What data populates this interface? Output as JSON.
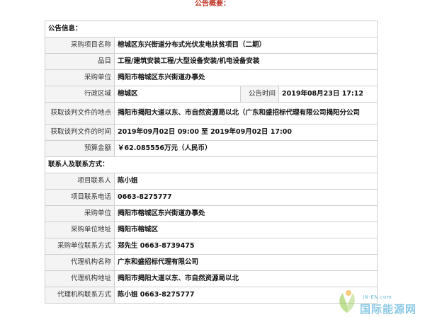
{
  "page": {
    "title": "公告概要："
  },
  "sections": {
    "announcement_info": "公告信息：",
    "contact_info": "联系人及联系方式："
  },
  "announcement": {
    "project_name_label": "采购项目名称",
    "project_name": "榕城区东兴街道分布式光伏发电扶贫项目（二期）",
    "category_label": "品目",
    "category": "工程/建筑安装工程/大型设备安装/机电设备安装",
    "purchaser_label": "采购单位",
    "purchaser": "揭阳市榕城区东兴街道办事处",
    "region_label": "行政区域",
    "region": "榕城区",
    "publish_time_label": "公告时间",
    "publish_time": "2019年08月23日 17:12",
    "doc_location_label": "获取谈判文件的地点",
    "doc_location": "揭阳市揭阳大道以东、市自然资源局以北（广东和盛招标代理有限公司揭阳分公司",
    "doc_time_label": "获取谈判文件的时间",
    "doc_time": "2019年09月02日 09:00 至 2019年09月02日 17:00",
    "budget_label": "预算金额",
    "budget": "￥62.085556万元（人民币）"
  },
  "contacts": {
    "project_contact_label": "项目联系人",
    "project_contact": "陈小姐",
    "project_phone_label": "项目联系电话",
    "project_phone": "0663-8275777",
    "purchaser_label": "采购单位",
    "purchaser": "揭阳市榕城区东兴街道办事处",
    "purchaser_address_label": "采购单位地址",
    "purchaser_address": "揭阳市榕城区",
    "purchaser_contact_label": "采购单位联系方式",
    "purchaser_contact": "郑先生 0663-8739475",
    "agency_name_label": "代理机构名称",
    "agency_name": "广东和盛招标代理有限公司",
    "agency_address_label": "代理机构地址",
    "agency_address": "揭阳市揭阳大道以东、市自然资源局以北",
    "agency_contact_label": "代理机构联系方式",
    "agency_contact": "陈小姐 0663-8275777"
  },
  "watermark": {
    "url": "IN-EN.com",
    "name": "国际能源网",
    "icon": "leaf-logo-icon",
    "colors": {
      "leaf_green": "#8cc63f",
      "leaf_orange": "#f5a623",
      "text_blue": "#8cc9e4"
    }
  }
}
